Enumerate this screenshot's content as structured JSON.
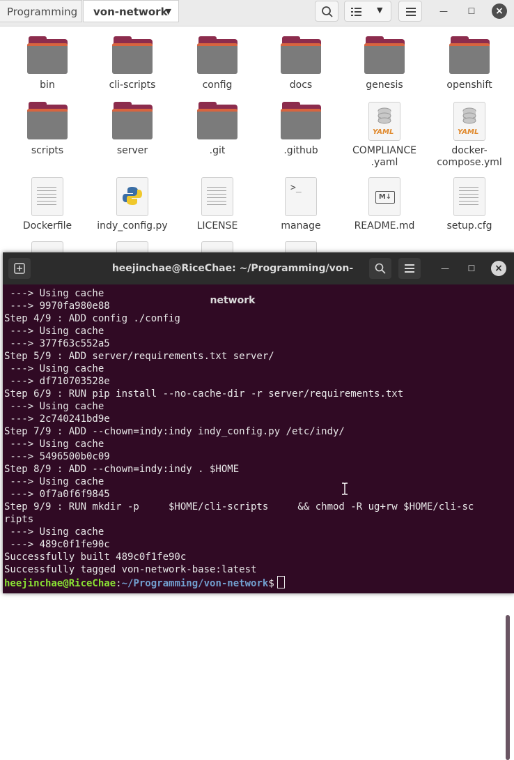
{
  "file_manager": {
    "breadcrumb": {
      "root": "Programming",
      "current": "von-network"
    },
    "items": [
      {
        "label": "bin",
        "type": "folder"
      },
      {
        "label": "cli-scripts",
        "type": "folder"
      },
      {
        "label": "config",
        "type": "folder"
      },
      {
        "label": "docs",
        "type": "folder"
      },
      {
        "label": "genesis",
        "type": "folder"
      },
      {
        "label": "openshift",
        "type": "folder"
      },
      {
        "label": "scripts",
        "type": "folder"
      },
      {
        "label": "server",
        "type": "folder"
      },
      {
        "label": ".git",
        "type": "folder"
      },
      {
        "label": ".github",
        "type": "folder"
      },
      {
        "label": "COMPLIANCE\n.yaml",
        "type": "yaml"
      },
      {
        "label": "docker-\ncompose.yml",
        "type": "yaml"
      },
      {
        "label": "Dockerfile",
        "type": "text"
      },
      {
        "label": "indy_config.py",
        "type": "python"
      },
      {
        "label": "LICENSE",
        "type": "text"
      },
      {
        "label": "manage",
        "type": "script"
      },
      {
        "label": "README.md",
        "type": "markdown"
      },
      {
        "label": "setup.cfg",
        "type": "text"
      }
    ],
    "icons": {
      "yaml_badge": "YAML",
      "script_glyph": ">_",
      "markdown_badge": "M↓"
    }
  },
  "terminal": {
    "title": "heejinchae@RiceChae: ~/Programming/von-network",
    "lines": [
      " ---> Using cache",
      " ---> 9970fa980e88",
      "Step 4/9 : ADD config ./config",
      " ---> Using cache",
      " ---> 377f63c552a5",
      "Step 5/9 : ADD server/requirements.txt server/",
      " ---> Using cache",
      " ---> df710703528e",
      "Step 6/9 : RUN pip install --no-cache-dir -r server/requirements.txt",
      " ---> Using cache",
      " ---> 2c740241bd9e",
      "Step 7/9 : ADD --chown=indy:indy indy_config.py /etc/indy/",
      " ---> Using cache",
      " ---> 5496500b0c09",
      "Step 8/9 : ADD --chown=indy:indy . $HOME",
      " ---> Using cache",
      " ---> 0f7a0f6f9845",
      "Step 9/9 : RUN mkdir -p     $HOME/cli-scripts     && chmod -R ug+rw $HOME/cli-sc",
      "ripts",
      " ---> Using cache",
      " ---> 489c0f1fe90c",
      "Successfully built 489c0f1fe90c",
      "Successfully tagged von-network-base:latest"
    ],
    "prompt": {
      "user_host": "heejinchae@RiceChae",
      "sep": ":",
      "path": "~/Programming/von-network",
      "dollar": "$"
    }
  },
  "colors": {
    "terminal_bg": "#300a24",
    "prompt_user": "#8ae234",
    "prompt_path": "#729fcf",
    "folder_tab": "#8c2c4d"
  }
}
